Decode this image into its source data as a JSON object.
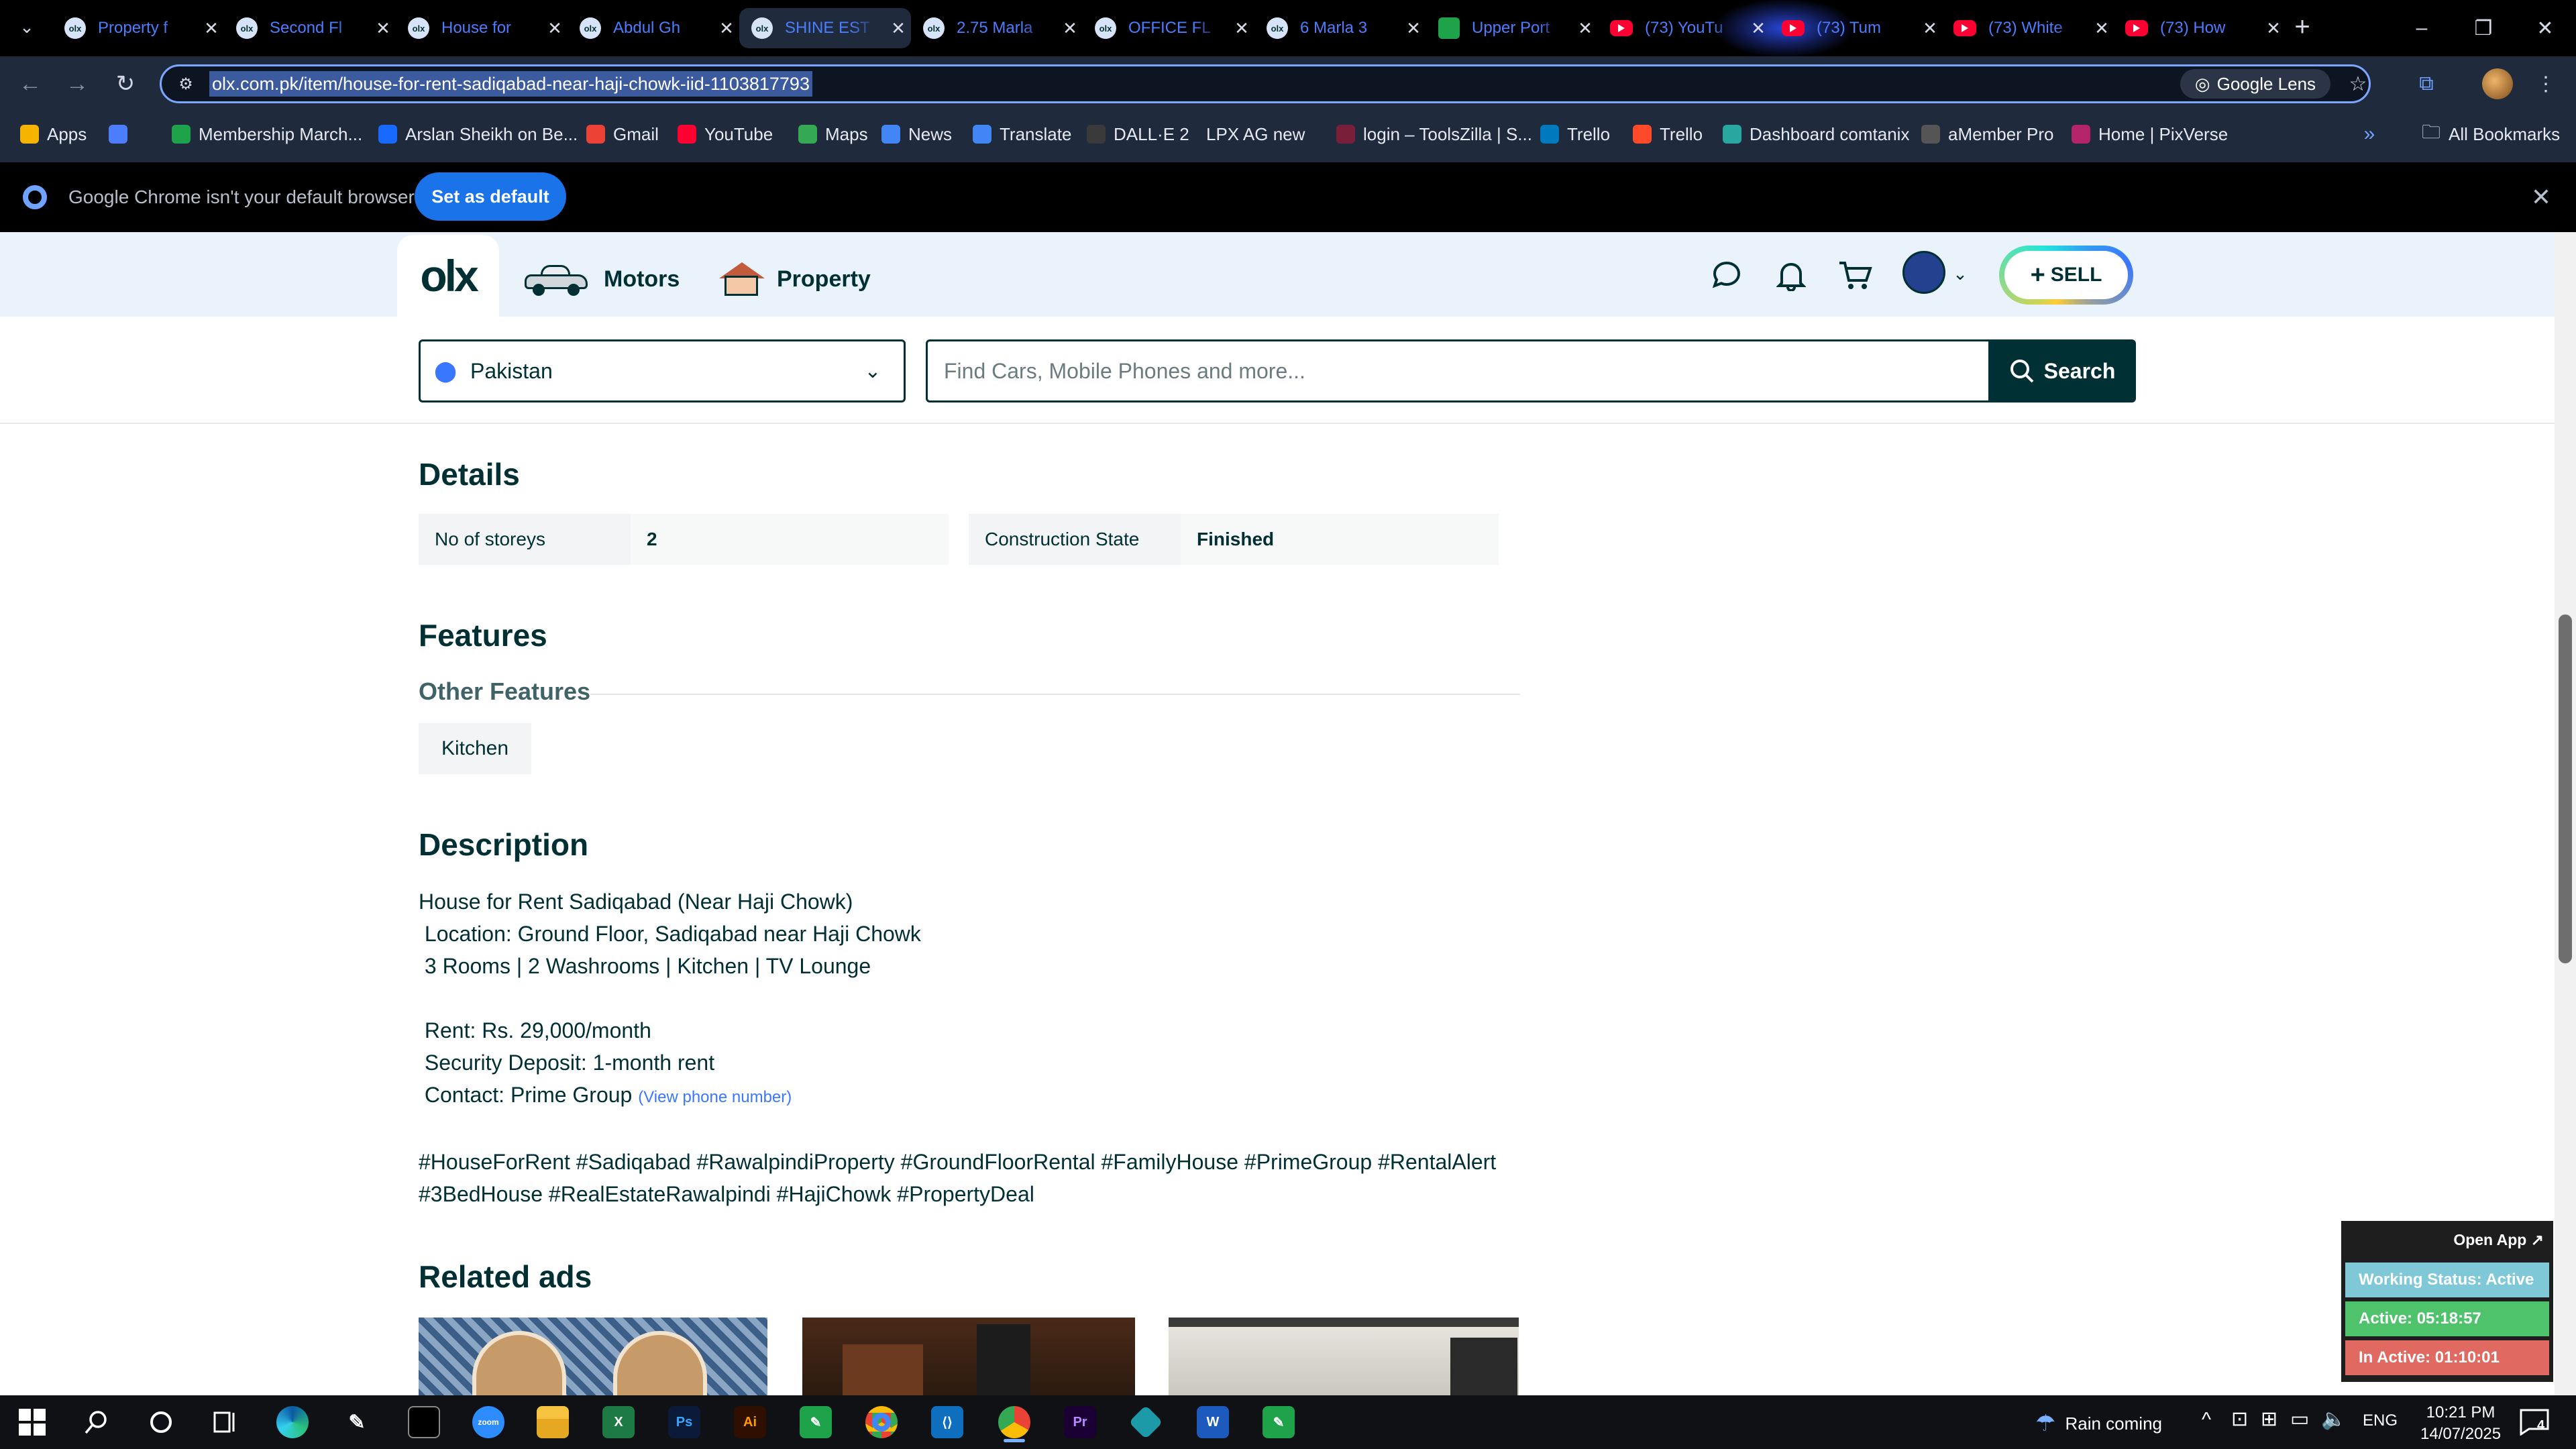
{
  "browser": {
    "tabs": [
      {
        "title": "Property f",
        "icon": "olx-favicon",
        "active": false
      },
      {
        "title": "Second Fl",
        "icon": "olx-favicon",
        "active": false
      },
      {
        "title": "House for",
        "icon": "olx-favicon",
        "active": false
      },
      {
        "title": "Abdul Gh",
        "icon": "olx-favicon",
        "active": false
      },
      {
        "title": "SHINE EST",
        "icon": "olx-favicon",
        "active": true
      },
      {
        "title": "2.75 Marla",
        "icon": "olx-favicon",
        "active": false
      },
      {
        "title": "OFFICE FL",
        "icon": "olx-favicon",
        "active": false
      },
      {
        "title": "6 Marla 3",
        "icon": "olx-favicon",
        "active": false
      },
      {
        "title": "Upper Port",
        "icon": "green-favicon",
        "active": false
      },
      {
        "title": "(73) YouTu",
        "icon": "youtube-favicon",
        "active": false
      },
      {
        "title": "(73) Tum",
        "icon": "youtube-favicon",
        "active": false
      },
      {
        "title": "(73) White",
        "icon": "youtube-favicon",
        "active": false
      },
      {
        "title": "(73) How",
        "icon": "youtube-favicon",
        "active": false
      }
    ],
    "url": "olx.com.pk/item/house-for-rent-sadiqabad-near-haji-chowk-iid-1103817793",
    "google_lens_label": "Google Lens",
    "bookmarks": [
      {
        "label": "Apps",
        "icon": "apps-grid-icon",
        "color": "#f5b400"
      },
      {
        "label": "",
        "icon": "grid-icon",
        "color": "#4d7dff"
      },
      {
        "label": "Membership March...",
        "icon": "sheets-icon",
        "color": "#1fa34a"
      },
      {
        "label": "Arslan Sheikh on Be...",
        "icon": "behance-icon",
        "color": "#1769ff"
      },
      {
        "label": "Gmail",
        "icon": "gmail-icon",
        "color": "#ea4335"
      },
      {
        "label": "YouTube",
        "icon": "youtube-icon",
        "color": "#ff0033"
      },
      {
        "label": "Maps",
        "icon": "maps-icon",
        "color": "#34a853"
      },
      {
        "label": "News",
        "icon": "news-icon",
        "color": "#4285f4"
      },
      {
        "label": "Translate",
        "icon": "translate-icon",
        "color": "#4285f4"
      },
      {
        "label": "DALL·E 2",
        "icon": "openai-icon",
        "color": "#3a3a3a"
      },
      {
        "label": "LPX AG new",
        "icon": "",
        "color": ""
      },
      {
        "label": "login – ToolsZilla | S...",
        "icon": "toolszilla-icon",
        "color": "#7a1f3a"
      },
      {
        "label": "Trello",
        "icon": "trello-icon",
        "color": "#0079bf"
      },
      {
        "label": "Trello",
        "icon": "trello-icon",
        "color": "#ff4a2a"
      },
      {
        "label": "Dashboard comtanix",
        "icon": "comtanix-icon",
        "color": "#2aa6a0"
      },
      {
        "label": "aMember Pro",
        "icon": "amember-icon",
        "color": "#555555"
      },
      {
        "label": "Home | PixVerse",
        "icon": "pixverse-icon",
        "color": "#b3246b"
      }
    ],
    "all_bookmarks_label": "All Bookmarks",
    "default_bar": {
      "message": "Google Chrome isn't your default browser",
      "button": "Set as default"
    }
  },
  "olx": {
    "logo": "olx",
    "categories": [
      {
        "label": "Motors",
        "icon": "car-icon"
      },
      {
        "label": "Property",
        "icon": "house-icon"
      }
    ],
    "sell_label": "SELL",
    "location": "Pakistan",
    "search_placeholder": "Find Cars, Mobile Phones and more...",
    "search_button": "Search",
    "accent_color": "#002f34"
  },
  "details": {
    "heading": "Details",
    "rows": [
      {
        "label": "No of storeys",
        "value": "2"
      },
      {
        "label": "Construction State",
        "value": "Finished"
      }
    ]
  },
  "features": {
    "heading": "Features",
    "subheading": "Other Features",
    "items": [
      "Kitchen"
    ]
  },
  "description": {
    "heading": "Description",
    "text_main": "House for Rent Sadiqabad (Near Haji Chowk)\n Location: Ground Floor, Sadiqabad near Haji Chowk\n 3 Rooms | 2 Washrooms | Kitchen | TV Lounge\n\n Rent: Rs. 29,000/month\n Security Deposit: 1-month rent\n Contact: Prime Group ",
    "phone_link": "(View phone number)",
    "hashtags": "\n\n#HouseForRent #Sadiqabad #RawalpindiProperty #GroundFloorRental #FamilyHouse #PrimeGroup #RentalAlert\n#3BedHouse #RealEstateRawalpindi #HajiChowk #PropertyDeal"
  },
  "related": {
    "heading": "Related ads"
  },
  "widget": {
    "open_app": "Open App ↗",
    "working_status": "Working Status: Active",
    "active": "Active: 05:18:57",
    "inactive": "In Active: 01:10:01",
    "colors": {
      "status": "#7ec8d8",
      "active": "#4fc26c",
      "inactive": "#e06a62"
    }
  },
  "taskbar": {
    "weather": "Rain coming",
    "language": "ENG",
    "time": "10:21 PM",
    "date": "14/07/2025",
    "notifications": "4"
  }
}
